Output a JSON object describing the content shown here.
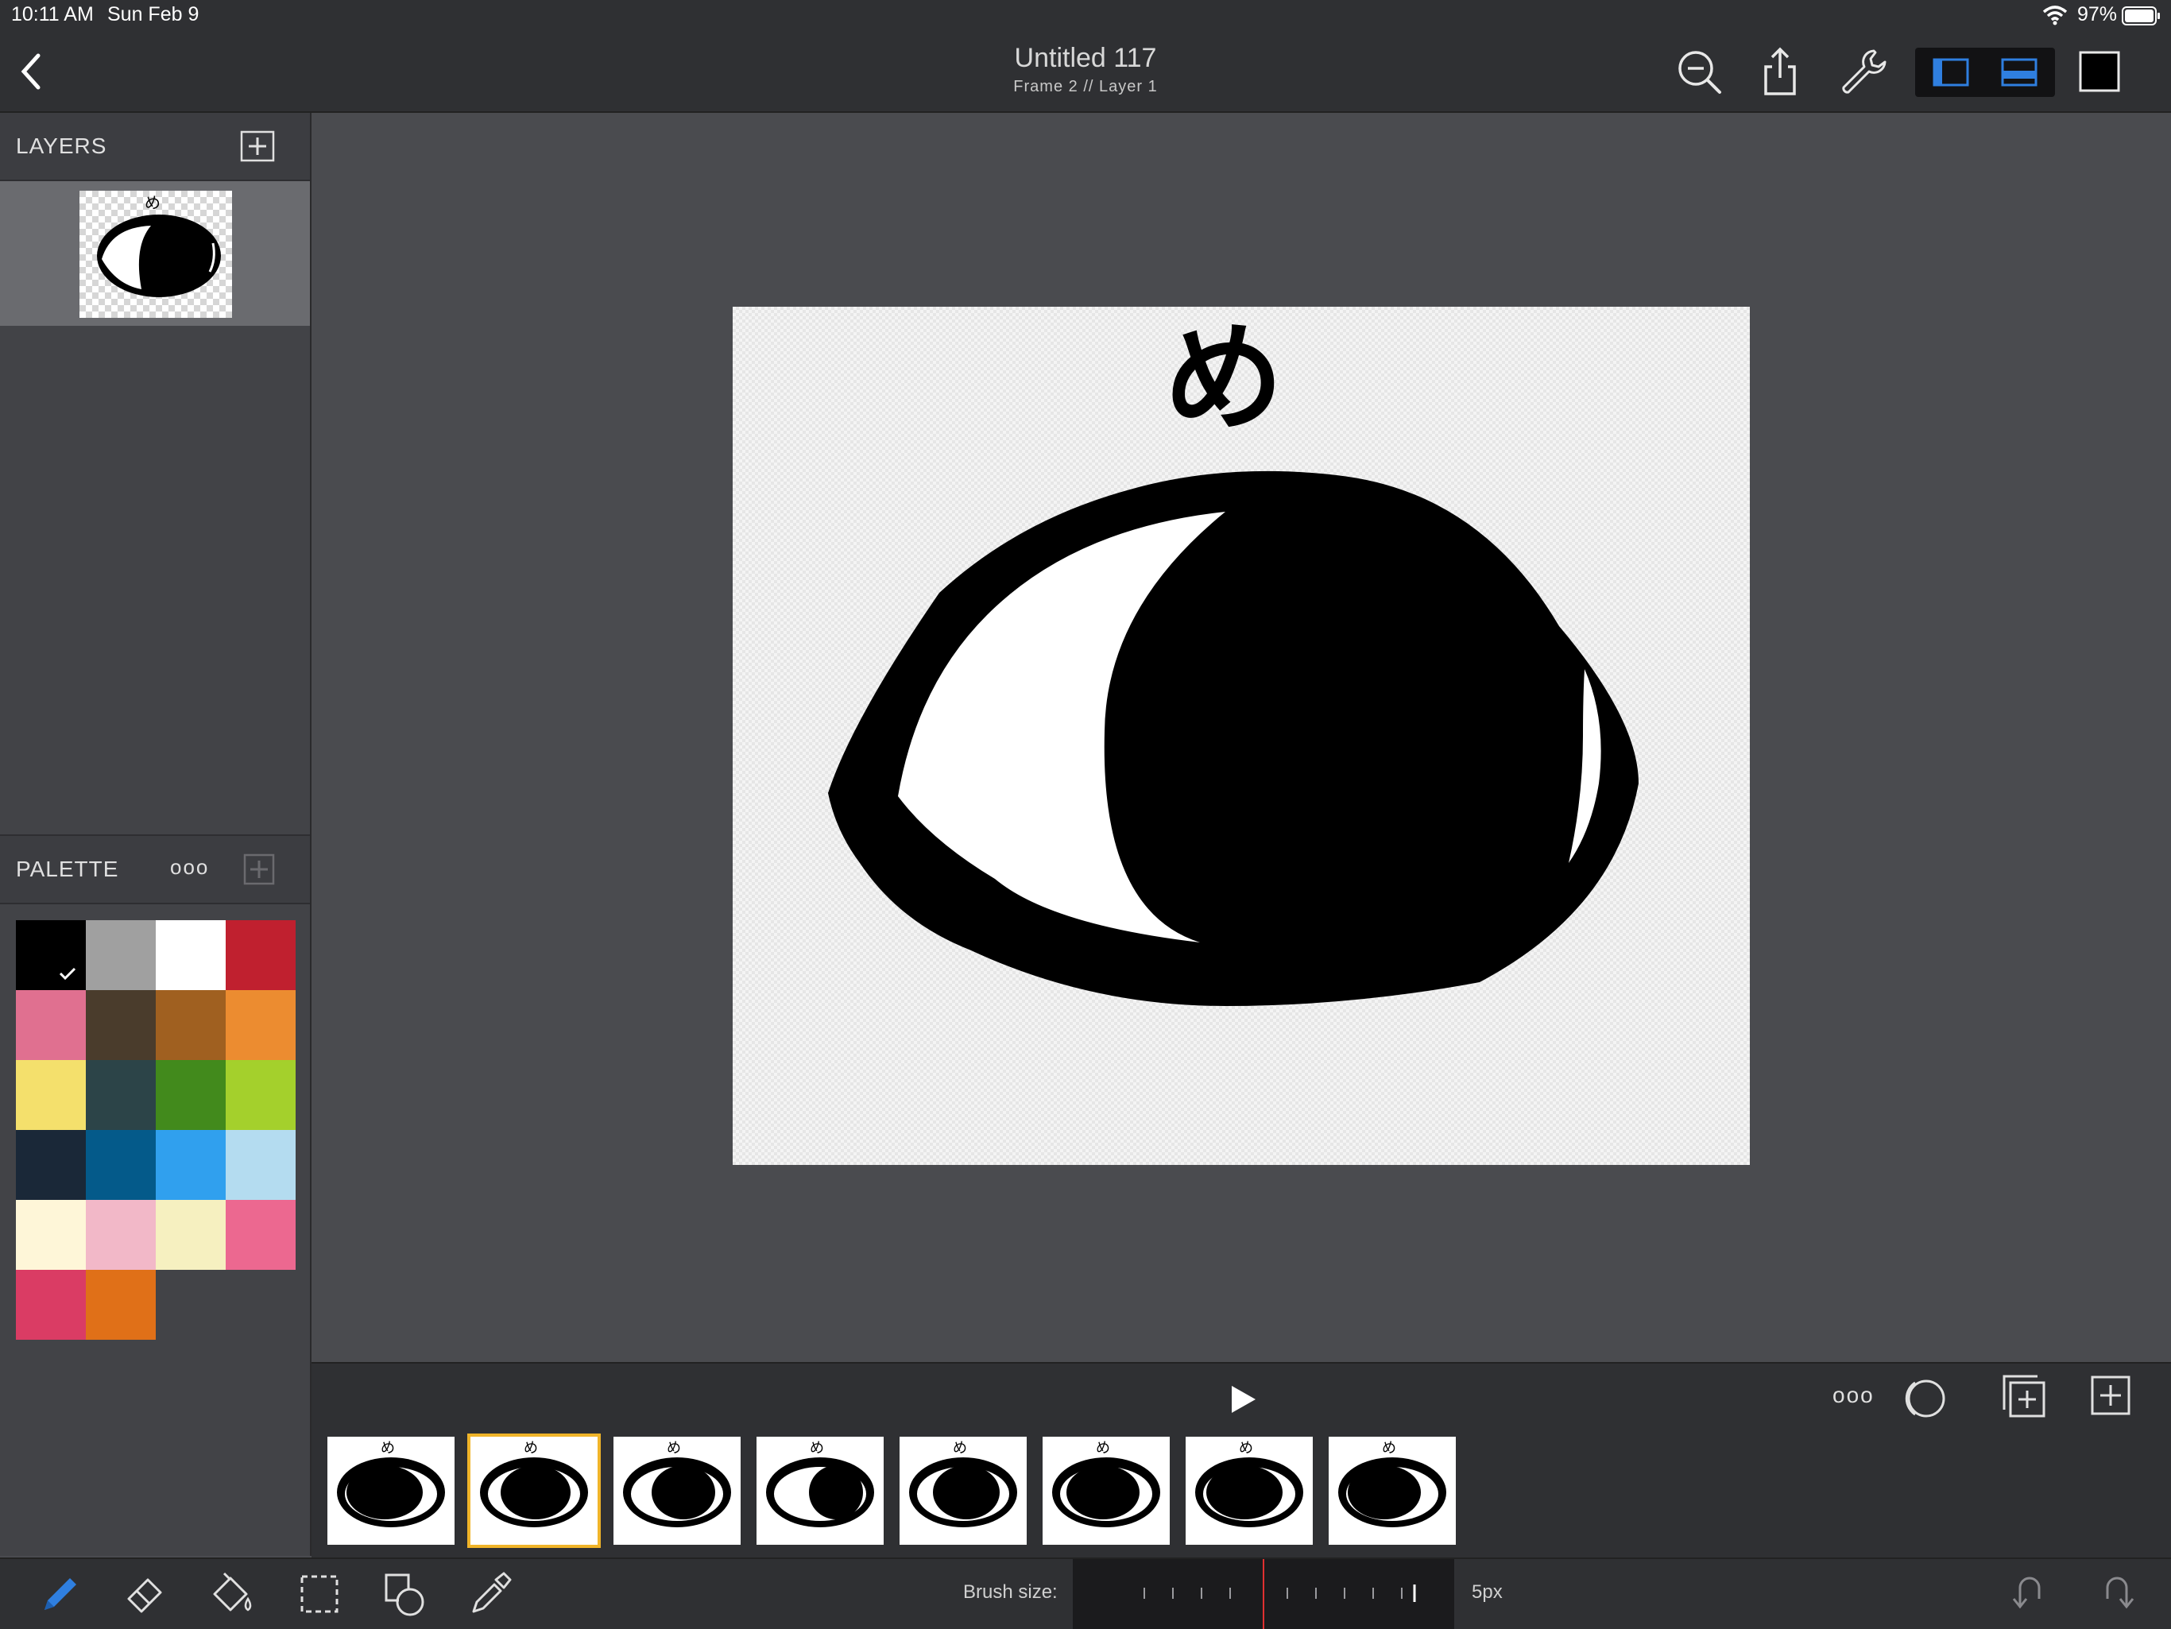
{
  "status_bar": {
    "time": "10:11 AM",
    "date": "Sun Feb 9",
    "battery": "97%",
    "icons": [
      "wifi-icon",
      "battery-icon"
    ]
  },
  "header": {
    "title": "Untitled 117",
    "subtitle": "Frame 2 // Layer 1",
    "buttons": [
      "back-icon",
      "zoom-out-icon",
      "share-icon",
      "wrench-icon",
      "sidebar-left-icon",
      "panel-bottom-icon",
      "color-square-icon"
    ]
  },
  "layers": {
    "label": "LAYERS",
    "add_icon": "plus-box-icon",
    "items": [
      {
        "name": "Layer 1",
        "selected": true
      }
    ]
  },
  "palette": {
    "label": "PALETTE",
    "more_label": "ooo",
    "selected_index": 0,
    "colors": [
      "#000000",
      "#a0a0a0",
      "#ffffff",
      "#c0202f",
      "#e07090",
      "#4a3c2c",
      "#a06020",
      "#ec8c30",
      "#f4e06c",
      "#2c4448",
      "#428a1c",
      "#a4d02c",
      "#1a2838",
      "#045a8a",
      "#30a0ee",
      "#b4dcf0",
      "#fef6d8",
      "#f2b8c8",
      "#f6f0c0",
      "#ec6890",
      "#da3c64",
      "#e07018"
    ]
  },
  "timeline": {
    "frame_count": 8,
    "selected_frame": 1,
    "more_label": "ooo",
    "icons": [
      "play-icon",
      "more-icon",
      "onion-skin-icon",
      "duplicate-frame-icon",
      "add-frame-icon"
    ]
  },
  "toolbar": {
    "tools": [
      "pencil-icon",
      "eraser-icon",
      "fill-bucket-icon",
      "select-icon",
      "shapes-icon",
      "eyedropper-icon"
    ],
    "active_tool": "pencil-icon",
    "brush_label": "Brush size:",
    "brush_value": "5px",
    "undo_icon": "undo-icon",
    "redo_icon": "redo-icon"
  },
  "colors": {
    "accent": "#2f7fe0",
    "selected_frame": "#f0b429",
    "slider_marker": "#e03030"
  }
}
